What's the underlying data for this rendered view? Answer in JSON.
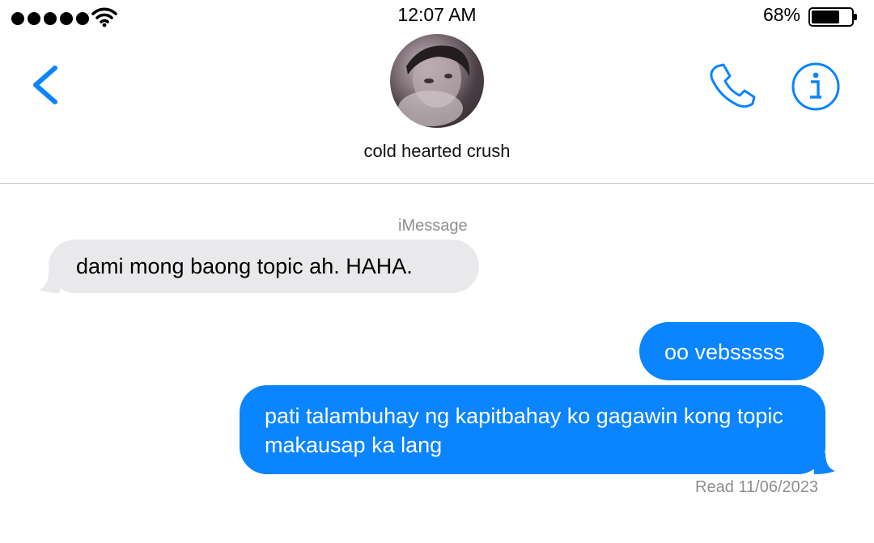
{
  "status_bar": {
    "time": "12:07 AM",
    "battery_percent": "68%",
    "battery_level": 0.68,
    "signal_bars": 5
  },
  "header": {
    "contact_name": "cold hearted crush",
    "icons": [
      "chevron-left-icon",
      "phone-icon",
      "info-icon"
    ],
    "accent_color": "#0a84ff"
  },
  "conversation": {
    "service_label": "iMessage",
    "messages": [
      {
        "direction": "incoming",
        "text": "dami mong baong topic ah. HAHA."
      },
      {
        "direction": "outgoing",
        "text": "oo vebsssss"
      },
      {
        "direction": "outgoing",
        "text": "pati talambuhay ng kapitbahay ko gagawin kong topic makausap ka lang"
      }
    ],
    "read_receipt": "Read 11/06/2023",
    "colors": {
      "incoming_bubble": "#e9e9eb",
      "outgoing_bubble": "#0a84ff",
      "meta_text": "#8e8e93"
    }
  }
}
